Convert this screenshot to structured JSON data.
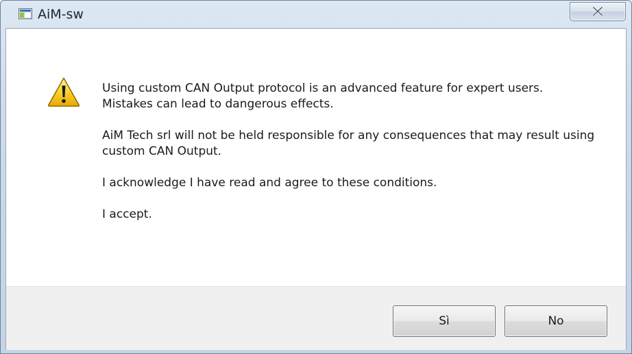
{
  "window": {
    "title": "AiM-sw",
    "icons": {
      "app": "app-window-icon",
      "close": "close-icon",
      "warning": "warning-icon"
    }
  },
  "dialog": {
    "paragraphs": [
      "Using custom CAN Output protocol is an advanced feature for expert users. Mistakes can lead to dangerous effects.",
      "AiM Tech srl will not be held responsible for any consequences that may result using custom CAN Output.",
      "I acknowledge I have read and agree to these conditions.",
      "I accept."
    ]
  },
  "buttons": {
    "yes_label": "Sì",
    "no_label": "No"
  },
  "colors": {
    "title_bar": "#c3d4e7",
    "footer": "#f0f0f0",
    "warning_yellow": "#f5c400"
  }
}
